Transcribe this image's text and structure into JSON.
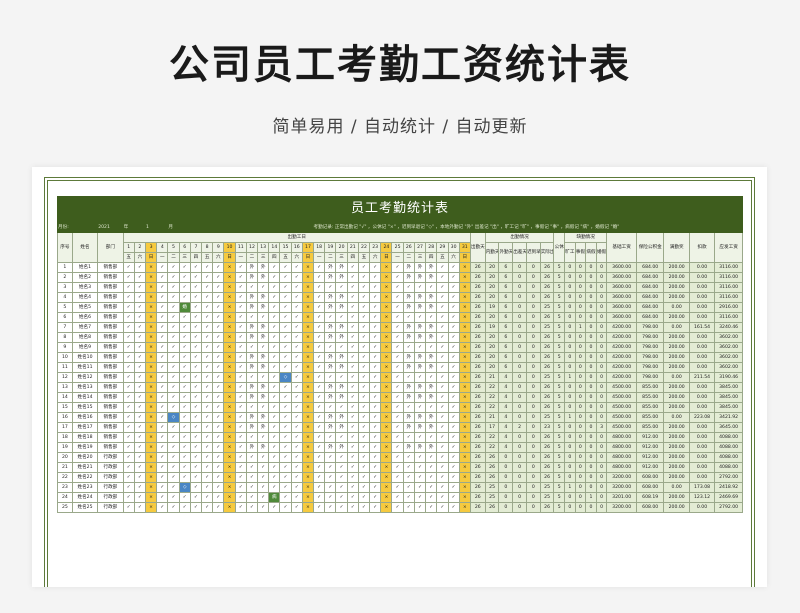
{
  "page": {
    "title": "公司员工考勤工资统计表",
    "subtitle": "简单易用  /  自动统计  /  自动更新"
  },
  "sheet": {
    "title": "员工考勤统计表",
    "info": {
      "month_label": "月份:",
      "year": "2021",
      "year_unit": "年",
      "month": "1",
      "month_unit": "月",
      "legend": "考勤记录: 正常出勤记 \"√\" ，公休记 \"×\" ，迟到早退记 \"◇\" ，本地外勤记 \"外\" 出差记 \"出\" ，旷工记 \"旷\" ，事假记 \"事\" ，病假记 \"病\" ，婚假记 \"婚\""
    },
    "headers": {
      "no": "序号",
      "name": "姓名",
      "dept": "部门",
      "days_group": "出勤工日",
      "attend": "出勤天数",
      "in_group": "出勤情况",
      "in_cols": [
        "内勤天数",
        "外勤天数",
        "出差天数",
        "迟到早退",
        "实际出勤"
      ],
      "rest": "公休",
      "leave_group": "缺勤情况",
      "leave_cols": [
        "旷工",
        "事假",
        "病假",
        "婚假"
      ],
      "base": "基础工资",
      "ins": "保险公积金",
      "bonus": "满勤奖",
      "deduct": "扣款",
      "pay": "应发工资"
    },
    "day_numbers": [
      "1",
      "2",
      "3",
      "4",
      "5",
      "6",
      "7",
      "8",
      "9",
      "10",
      "11",
      "12",
      "13",
      "14",
      "15",
      "16",
      "17",
      "18",
      "19",
      "20",
      "21",
      "22",
      "23",
      "24",
      "25",
      "26",
      "27",
      "28",
      "29",
      "30",
      "31"
    ],
    "weekdays": [
      "五",
      "六",
      "日",
      "一",
      "二",
      "三",
      "四",
      "五",
      "六",
      "日",
      "一",
      "二",
      "三",
      "四",
      "五",
      "六",
      "日",
      "一",
      "二",
      "三",
      "四",
      "五",
      "六",
      "日",
      "一",
      "二",
      "三",
      "四",
      "五",
      "六",
      "日"
    ],
    "rows": [
      {
        "no": "1",
        "name": "姓名1",
        "dept": "销售部",
        "attend": "26",
        "stats": [
          "20",
          "6",
          "0",
          "0",
          "26",
          "5",
          "0",
          "0",
          "0",
          "0"
        ],
        "base": "3600.00",
        "ins": "684.00",
        "bonus": "200.00",
        "deduct": "0.00",
        "pay": "3116.00"
      },
      {
        "no": "2",
        "name": "姓名2",
        "dept": "销售部",
        "attend": "26",
        "stats": [
          "20",
          "6",
          "0",
          "0",
          "26",
          "5",
          "0",
          "0",
          "0",
          "0"
        ],
        "base": "3600.00",
        "ins": "684.00",
        "bonus": "200.00",
        "deduct": "0.00",
        "pay": "3116.00"
      },
      {
        "no": "3",
        "name": "姓名3",
        "dept": "销售部",
        "attend": "26",
        "stats": [
          "20",
          "6",
          "0",
          "0",
          "26",
          "5",
          "0",
          "0",
          "0",
          "0"
        ],
        "base": "3600.00",
        "ins": "684.00",
        "bonus": "200.00",
        "deduct": "0.00",
        "pay": "3116.00"
      },
      {
        "no": "4",
        "name": "姓名4",
        "dept": "销售部",
        "attend": "26",
        "stats": [
          "20",
          "6",
          "0",
          "0",
          "26",
          "5",
          "0",
          "0",
          "0",
          "0"
        ],
        "base": "3600.00",
        "ins": "684.00",
        "bonus": "200.00",
        "deduct": "0.00",
        "pay": "3116.00"
      },
      {
        "no": "5",
        "name": "姓名5",
        "dept": "销售部",
        "attend": "26",
        "stats": [
          "19",
          "6",
          "0",
          "0",
          "25",
          "5",
          "0",
          "0",
          "0",
          "0"
        ],
        "base": "3600.00",
        "ins": "684.00",
        "bonus": "0.00",
        "deduct": "0.00",
        "pay": "2916.00"
      },
      {
        "no": "6",
        "name": "姓名6",
        "dept": "销售部",
        "attend": "26",
        "stats": [
          "20",
          "6",
          "0",
          "0",
          "26",
          "5",
          "0",
          "0",
          "0",
          "0"
        ],
        "base": "3600.00",
        "ins": "684.00",
        "bonus": "200.00",
        "deduct": "0.00",
        "pay": "3116.00"
      },
      {
        "no": "7",
        "name": "姓名7",
        "dept": "销售部",
        "attend": "26",
        "stats": [
          "19",
          "6",
          "0",
          "0",
          "25",
          "5",
          "0",
          "1",
          "0",
          "0"
        ],
        "base": "4200.00",
        "ins": "798.00",
        "bonus": "0.00",
        "deduct": "161.54",
        "pay": "3240.46"
      },
      {
        "no": "8",
        "name": "姓名8",
        "dept": "销售部",
        "attend": "26",
        "stats": [
          "20",
          "6",
          "0",
          "0",
          "26",
          "5",
          "0",
          "0",
          "0",
          "0"
        ],
        "base": "4200.00",
        "ins": "798.00",
        "bonus": "200.00",
        "deduct": "0.00",
        "pay": "3602.00"
      },
      {
        "no": "9",
        "name": "姓名9",
        "dept": "销售部",
        "attend": "26",
        "stats": [
          "20",
          "6",
          "0",
          "0",
          "26",
          "5",
          "0",
          "0",
          "0",
          "0"
        ],
        "base": "4200.00",
        "ins": "798.00",
        "bonus": "200.00",
        "deduct": "0.00",
        "pay": "3602.00"
      },
      {
        "no": "10",
        "name": "姓名10",
        "dept": "销售部",
        "attend": "26",
        "stats": [
          "20",
          "6",
          "0",
          "0",
          "26",
          "5",
          "0",
          "0",
          "0",
          "0"
        ],
        "base": "4200.00",
        "ins": "798.00",
        "bonus": "200.00",
        "deduct": "0.00",
        "pay": "3602.00"
      },
      {
        "no": "11",
        "name": "姓名11",
        "dept": "销售部",
        "attend": "26",
        "stats": [
          "20",
          "6",
          "0",
          "0",
          "26",
          "5",
          "0",
          "0",
          "0",
          "0"
        ],
        "base": "4200.00",
        "ins": "798.00",
        "bonus": "200.00",
        "deduct": "0.00",
        "pay": "3602.00"
      },
      {
        "no": "12",
        "name": "姓名12",
        "dept": "销售部",
        "attend": "26",
        "stats": [
          "21",
          "4",
          "0",
          "0",
          "25",
          "5",
          "1",
          "0",
          "0",
          "0"
        ],
        "base": "4200.00",
        "ins": "798.00",
        "bonus": "0.00",
        "deduct": "211.54",
        "pay": "3190.46"
      },
      {
        "no": "13",
        "name": "姓名13",
        "dept": "销售部",
        "attend": "26",
        "stats": [
          "22",
          "4",
          "0",
          "0",
          "26",
          "5",
          "0",
          "0",
          "0",
          "0"
        ],
        "base": "4500.00",
        "ins": "855.00",
        "bonus": "200.00",
        "deduct": "0.00",
        "pay": "3845.00"
      },
      {
        "no": "14",
        "name": "姓名14",
        "dept": "销售部",
        "attend": "26",
        "stats": [
          "22",
          "4",
          "0",
          "0",
          "26",
          "5",
          "0",
          "0",
          "0",
          "0"
        ],
        "base": "4500.00",
        "ins": "855.00",
        "bonus": "200.00",
        "deduct": "0.00",
        "pay": "3845.00"
      },
      {
        "no": "15",
        "name": "姓名15",
        "dept": "销售部",
        "attend": "26",
        "stats": [
          "22",
          "4",
          "0",
          "0",
          "26",
          "5",
          "0",
          "0",
          "0",
          "0"
        ],
        "base": "4500.00",
        "ins": "855.00",
        "bonus": "200.00",
        "deduct": "0.00",
        "pay": "3845.00"
      },
      {
        "no": "16",
        "name": "姓名16",
        "dept": "销售部",
        "attend": "26",
        "stats": [
          "21",
          "4",
          "0",
          "0",
          "25",
          "5",
          "1",
          "0",
          "0",
          "0"
        ],
        "base": "4500.00",
        "ins": "855.00",
        "bonus": "0.00",
        "deduct": "223.08",
        "pay": "3421.92"
      },
      {
        "no": "17",
        "name": "姓名17",
        "dept": "销售部",
        "attend": "26",
        "stats": [
          "17",
          "4",
          "2",
          "0",
          "23",
          "5",
          "0",
          "0",
          "0",
          "3"
        ],
        "base": "4500.00",
        "ins": "855.00",
        "bonus": "200.00",
        "deduct": "0.00",
        "pay": "3645.00"
      },
      {
        "no": "18",
        "name": "姓名18",
        "dept": "销售部",
        "attend": "26",
        "stats": [
          "22",
          "4",
          "0",
          "0",
          "26",
          "5",
          "0",
          "0",
          "0",
          "0"
        ],
        "base": "4800.00",
        "ins": "912.00",
        "bonus": "200.00",
        "deduct": "0.00",
        "pay": "4088.00"
      },
      {
        "no": "19",
        "name": "姓名19",
        "dept": "销售部",
        "attend": "26",
        "stats": [
          "22",
          "4",
          "0",
          "0",
          "26",
          "5",
          "0",
          "0",
          "0",
          "0"
        ],
        "base": "4800.00",
        "ins": "912.00",
        "bonus": "200.00",
        "deduct": "0.00",
        "pay": "4088.00"
      },
      {
        "no": "20",
        "name": "姓名20",
        "dept": "行政部",
        "attend": "26",
        "stats": [
          "26",
          "0",
          "0",
          "0",
          "26",
          "5",
          "0",
          "0",
          "0",
          "0"
        ],
        "base": "4800.00",
        "ins": "912.00",
        "bonus": "200.00",
        "deduct": "0.00",
        "pay": "4088.00"
      },
      {
        "no": "21",
        "name": "姓名21",
        "dept": "行政部",
        "attend": "26",
        "stats": [
          "26",
          "0",
          "0",
          "0",
          "26",
          "5",
          "0",
          "0",
          "0",
          "0"
        ],
        "base": "4800.00",
        "ins": "912.00",
        "bonus": "200.00",
        "deduct": "0.00",
        "pay": "4088.00"
      },
      {
        "no": "22",
        "name": "姓名22",
        "dept": "行政部",
        "attend": "26",
        "stats": [
          "26",
          "0",
          "0",
          "0",
          "26",
          "5",
          "0",
          "0",
          "0",
          "0"
        ],
        "base": "3200.00",
        "ins": "608.00",
        "bonus": "200.00",
        "deduct": "0.00",
        "pay": "2792.00"
      },
      {
        "no": "23",
        "name": "姓名23",
        "dept": "行政部",
        "attend": "26",
        "stats": [
          "25",
          "0",
          "0",
          "0",
          "25",
          "5",
          "1",
          "0",
          "0",
          "0"
        ],
        "base": "3200.00",
        "ins": "608.00",
        "bonus": "0.00",
        "deduct": "173.08",
        "pay": "2418.92"
      },
      {
        "no": "24",
        "name": "姓名24",
        "dept": "行政部",
        "attend": "26",
        "stats": [
          "25",
          "0",
          "0",
          "0",
          "25",
          "5",
          "0",
          "0",
          "1",
          "0"
        ],
        "base": "3201.00",
        "ins": "608.19",
        "bonus": "200.00",
        "deduct": "123.12",
        "pay": "2469.69"
      },
      {
        "no": "25",
        "name": "姓名25",
        "dept": "行政部",
        "attend": "26",
        "stats": [
          "26",
          "0",
          "0",
          "0",
          "26",
          "5",
          "0",
          "0",
          "0",
          "0"
        ],
        "base": "3200.00",
        "ins": "608.00",
        "bonus": "200.00",
        "deduct": "0.00",
        "pay": "2792.00"
      }
    ],
    "marks": {
      "normal": "✓",
      "rest": "×",
      "out": "外",
      "trip": "出",
      "sick": "病",
      "marriage": "婚",
      "personal": "事",
      "absent": "旷",
      "late": "◇"
    },
    "colors": {
      "header_green": "#3e5d1d",
      "weekend_yellow": "#f6ca3f",
      "blue_cell": "#4a86c5",
      "green_cell": "#4f8a3a",
      "stats_green": "#e3ecd4"
    }
  }
}
